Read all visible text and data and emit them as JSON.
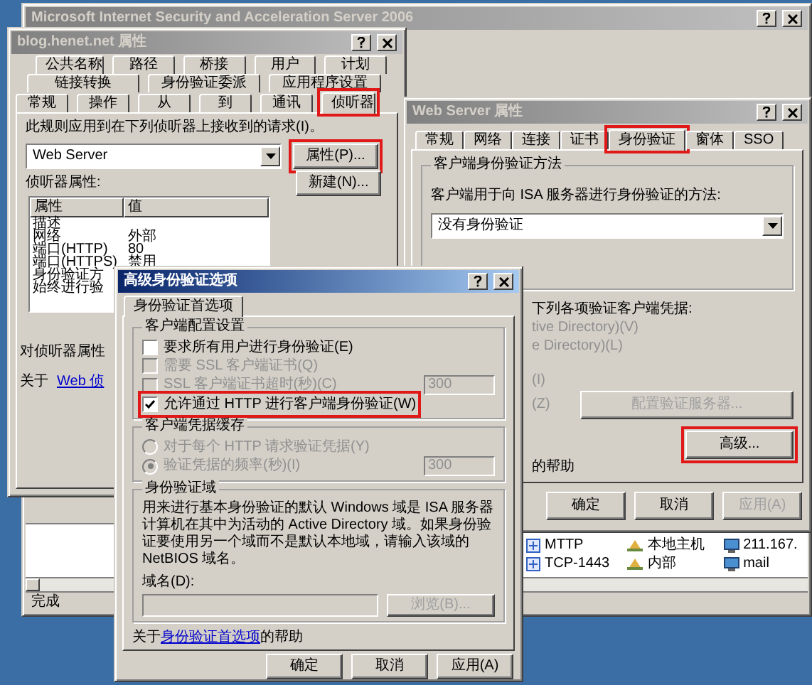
{
  "main_window": {
    "title": "Microsoft Internet Security and Acceleration Server 2006",
    "list_rows": [
      {
        "cells": [
          "MTTP",
          "本地主机",
          "211.167."
        ]
      },
      {
        "cells": [
          "TCP-1443",
          "内部",
          "mail"
        ]
      }
    ],
    "status_bar": "完成"
  },
  "rule_dialog": {
    "title": "blog.henet.net 属性",
    "tab_rows": [
      [
        {
          "label": "公共名称",
          "selected": false,
          "highlighted": false
        },
        {
          "label": "路径",
          "selected": false,
          "highlighted": false
        },
        {
          "label": "桥接",
          "selected": false,
          "highlighted": false
        },
        {
          "label": "用户",
          "selected": false,
          "highlighted": false
        },
        {
          "label": "计划",
          "selected": false,
          "highlighted": false
        }
      ],
      [
        {
          "label": "链接转换",
          "selected": false,
          "highlighted": false
        },
        {
          "label": "身份验证委派",
          "selected": false,
          "highlighted": false
        },
        {
          "label": "应用程序设置",
          "selected": false,
          "highlighted": false
        }
      ],
      [
        {
          "label": "常规",
          "selected": false,
          "highlighted": false
        },
        {
          "label": "操作",
          "selected": false,
          "highlighted": false
        },
        {
          "label": "从",
          "selected": false,
          "highlighted": false
        },
        {
          "label": "到",
          "selected": false,
          "highlighted": false
        },
        {
          "label": "通讯",
          "selected": false,
          "highlighted": false
        },
        {
          "label": "侦听器",
          "selected": true,
          "highlighted": true
        }
      ]
    ],
    "description": "此规则应用到在下列侦听器上接收到的请求(I)。",
    "listener": "Web Server",
    "buttons": [
      {
        "label": "属性(P)...",
        "highlighted": true
      },
      {
        "label": "新建(N)...",
        "highlighted": false
      }
    ],
    "properties_label": "侦听器属性:",
    "properties_table": {
      "columns": [
        "属性",
        "值"
      ],
      "rows": [
        {
          "name": "描述"
        },
        {
          "name": "网络",
          "value": "外部"
        },
        {
          "name": "端口(HTTP)",
          "value": "80"
        },
        {
          "name": "端口(HTTPS)",
          "value": "禁用"
        },
        {
          "name": "身份验证方"
        },
        {
          "name": "始终进行验"
        }
      ]
    },
    "note": "对侦听器属性",
    "help_prefix": "关于",
    "help_link": "Web 侦"
  },
  "listener_dialog": {
    "title": "Web Server 属性",
    "tabs": [
      {
        "label": "常规",
        "selected": false,
        "highlighted": false
      },
      {
        "label": "网络",
        "selected": false,
        "highlighted": false
      },
      {
        "label": "连接",
        "selected": false,
        "highlighted": false
      },
      {
        "label": "证书",
        "selected": false,
        "highlighted": false
      },
      {
        "label": "身份验证",
        "selected": true,
        "highlighted": true
      },
      {
        "label": "窗体",
        "selected": false,
        "highlighted": false
      },
      {
        "label": "SSO",
        "selected": false,
        "highlighted": false
      }
    ],
    "method_group": {
      "title": "客户端身份验证方法",
      "label": "客户端用于向 ISA 服务器进行身份验证的方法:",
      "value": "没有身份验证"
    },
    "validation_label": "下列各项验证客户端凭据:",
    "validation_options": [
      "tive Directory)(V)",
      "e Directory)(L)",
      "(I)",
      "(Z)"
    ],
    "configure_button": {
      "label": "配置验证服务器...",
      "disabled": true,
      "highlighted": false
    },
    "advanced_button": {
      "label": "高级...",
      "disabled": false,
      "highlighted": true
    },
    "help_text": "的帮助",
    "buttons": [
      {
        "label": "确定",
        "disabled": false
      },
      {
        "label": "取消",
        "disabled": false
      },
      {
        "label": "应用(A)",
        "disabled": true
      }
    ]
  },
  "advanced_dialog": {
    "title": "高级身份验证选项",
    "tabs": [
      {
        "label": "身份验证首选项",
        "selected": true
      }
    ],
    "client_config": {
      "title": "客户端配置设置",
      "options": [
        {
          "label": "要求所有用户进行身份验证(E)",
          "checked": false,
          "disabled": false,
          "highlighted": false
        },
        {
          "label": "需要 SSL 客户端证书(Q)",
          "checked": false,
          "disabled": true,
          "highlighted": false
        },
        {
          "label": "SSL 客户端证书超时(秒)(C)",
          "checked": false,
          "disabled": true,
          "highlighted": false,
          "value": "300"
        },
        {
          "label": "允许通过 HTTP 进行客户端身份验证(W)",
          "checked": true,
          "disabled": false,
          "highlighted": true
        }
      ]
    },
    "credential_cache": {
      "title": "客户端凭据缓存",
      "options": [
        {
          "label": "对于每个 HTTP 请求验证凭据(Y)",
          "selected": false,
          "disabled": true
        },
        {
          "label": "验证凭据的频率(秒)(I)",
          "selected": true,
          "disabled": true,
          "value": "300"
        }
      ]
    },
    "auth_domain": {
      "title": "身份验证域",
      "description": "用来进行基本身份验证的默认 Windows 域是 ISA 服务器计算机在其中为活动的 Active Directory 域。如果身份验证要使用另一个域而不是默认本地域，请输入该域的 NetBIOS 域名。",
      "domain_label": "域名(D):",
      "domain_field": {
        "disabled": true
      },
      "browse_button": {
        "label": "浏览(B)...",
        "disabled": true
      }
    },
    "help_prefix": "关于",
    "help_link": "身份验证首选项",
    "help_suffix": "的帮助",
    "buttons": [
      {
        "label": "确定",
        "disabled": false
      },
      {
        "label": "取消",
        "disabled": false
      },
      {
        "label": "应用(A)",
        "disabled": false
      }
    ]
  }
}
